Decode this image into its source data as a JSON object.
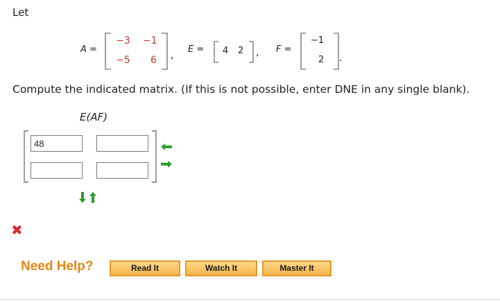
{
  "intro": "Let",
  "matrices": {
    "A": {
      "label": "A =",
      "r1c1": "−3",
      "r1c2": "−1",
      "r2c1": "−5",
      "r2c2": "6"
    },
    "E": {
      "label": "E =",
      "c1": "4",
      "c2": "2"
    },
    "F": {
      "label": "F =",
      "r1": "−1",
      "r2": "2"
    },
    "sep1": ",",
    "sep2": ",",
    "end": "."
  },
  "prompt": "Compute the indicated matrix. (If this is not possible, enter DNE in any single blank).",
  "expression": "E(AF)",
  "answer": {
    "cells": [
      "48",
      "",
      "",
      ""
    ]
  },
  "status": {
    "icon": "incorrect-x-icon",
    "symbol": "✖",
    "color": "#e0272b"
  },
  "help": {
    "label": "Need Help?",
    "buttons": [
      "Read It",
      "Watch It",
      "Master It"
    ]
  },
  "colors": {
    "accent": "#e48714",
    "arrow": "#2e9c2e",
    "entries": "#c0392b"
  }
}
